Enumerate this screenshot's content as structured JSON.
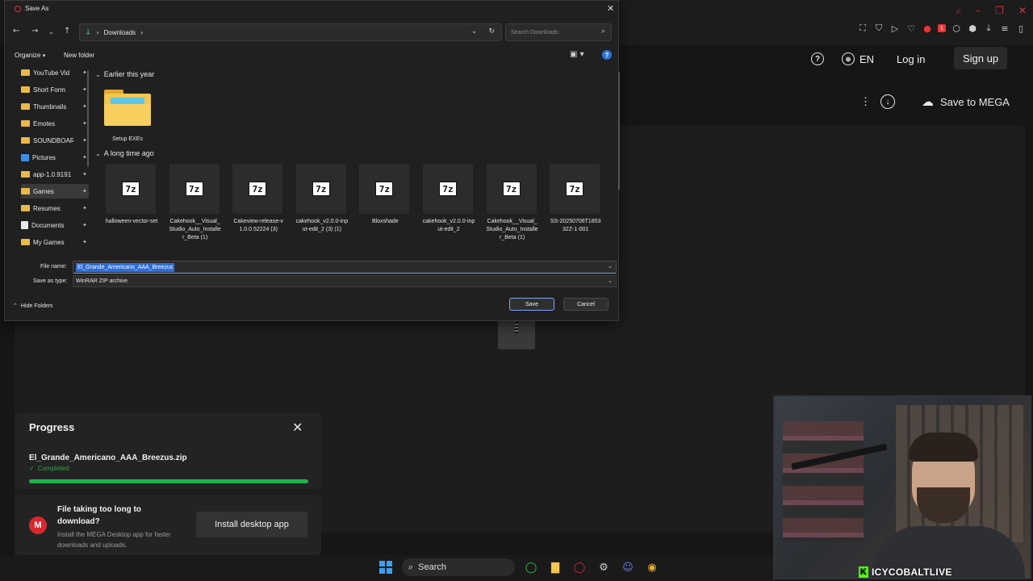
{
  "browser": {
    "header": {
      "language": "EN",
      "login": "Log in",
      "signup": "Sign up"
    },
    "toolbar": {
      "save_to_mega": "Save to MEGA"
    },
    "tab_badge": "1"
  },
  "progress": {
    "title": "Progress",
    "filename": "El_Grande_Americano_AAA_Breezus.zip",
    "status": "Completed",
    "percent": 100
  },
  "desktop_promo": {
    "logo": "M",
    "title": "File taking too long to download?",
    "subtitle": "Install the MEGA Desktop app for faster downloads and uploads.",
    "button": "Install desktop app"
  },
  "taskbar": {
    "search_label": "Search"
  },
  "webcam": {
    "channel": "ICYCOBALTLIVE",
    "kick_logo": "K"
  },
  "dialog": {
    "title": "Save As",
    "address": {
      "crumb": "Downloads",
      "search_placeholder": "Search Downloads"
    },
    "commands": {
      "organize": "Organize",
      "new_folder": "New folder"
    },
    "sidebar": [
      {
        "label": "YouTube Vid",
        "icon": "folder"
      },
      {
        "label": "Short Form",
        "icon": "folder"
      },
      {
        "label": "Thumbnails",
        "icon": "folder"
      },
      {
        "label": "Emotes",
        "icon": "folder"
      },
      {
        "label": "SOUNDBOAR",
        "icon": "folder"
      },
      {
        "label": "Pictures",
        "icon": "pictures"
      },
      {
        "label": "app-1.0.9191",
        "icon": "folder"
      },
      {
        "label": "Games",
        "icon": "folder",
        "selected": true
      },
      {
        "label": "Resumes",
        "icon": "folder"
      },
      {
        "label": "Documents",
        "icon": "documents"
      },
      {
        "label": "My Games",
        "icon": "folder"
      }
    ],
    "groups": {
      "recent": "Earlier this year",
      "old": "A long time ago"
    },
    "folder": {
      "name": "Setup EXEs"
    },
    "files": [
      {
        "name": "halloween-vector-set",
        "icon": "7z"
      },
      {
        "name": "Cakehook__Visual_Studio_Auto_Installer_Beta (1)",
        "icon": "7z"
      },
      {
        "name": "Cakeview-release-v1.0.0.52224 (3)",
        "icon": "7z"
      },
      {
        "name": "cakehook_v2.0.0-input-edit_2 (3) (1)",
        "icon": "7z"
      },
      {
        "name": "Bloxshade",
        "icon": "7z"
      },
      {
        "name": "cakehook_v2.0.0-input-edit_2",
        "icon": "7z"
      },
      {
        "name": "Cakehook__Visual_Studio_Auto_Installer_Beta (1)",
        "icon": "7z"
      },
      {
        "name": "SS-20250706T185332Z-1-001",
        "icon": "7z"
      }
    ],
    "filename_label": "File name:",
    "filename_value": "El_Grande_Americano_AAA_Breezus",
    "filetype_label": "Save as type:",
    "filetype_value": "WinRAR ZIP archive",
    "hide_folders": "Hide Folders",
    "save": "Save",
    "cancel": "Cancel"
  }
}
